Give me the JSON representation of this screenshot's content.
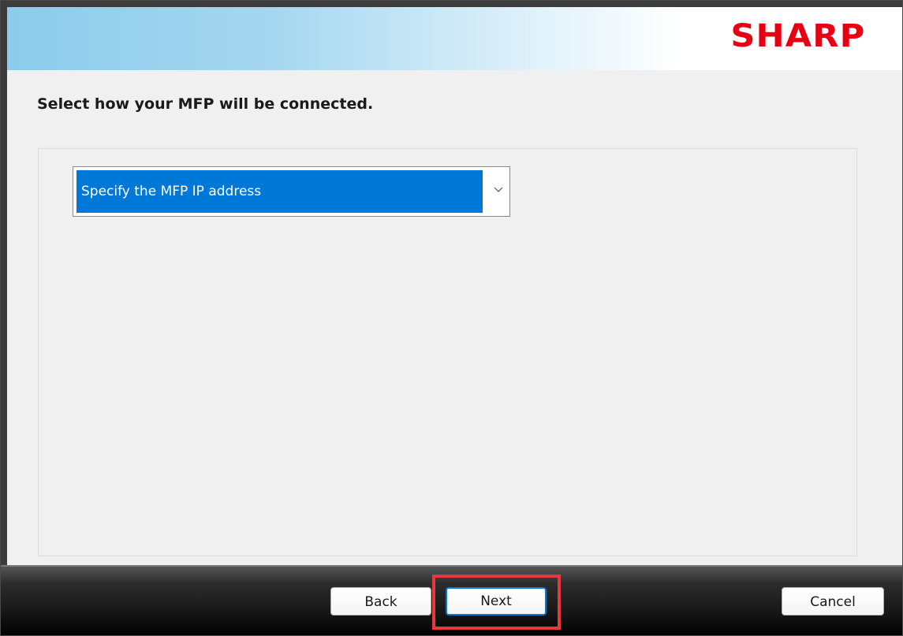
{
  "header": {
    "logo_text": "SHARP",
    "logo_color": "#e60012"
  },
  "main": {
    "heading": "Select how your MFP will be connected.",
    "connection_select": {
      "selected_value": "Specify the MFP IP address",
      "arrow_icon": "chevron-down-icon"
    }
  },
  "footer": {
    "back_label": "Back",
    "next_label": "Next",
    "cancel_label": "Cancel",
    "highlight_color": "#e8383d"
  },
  "colors": {
    "selection": "#0078d7",
    "header_gradient_start": "#8ccbeb"
  }
}
